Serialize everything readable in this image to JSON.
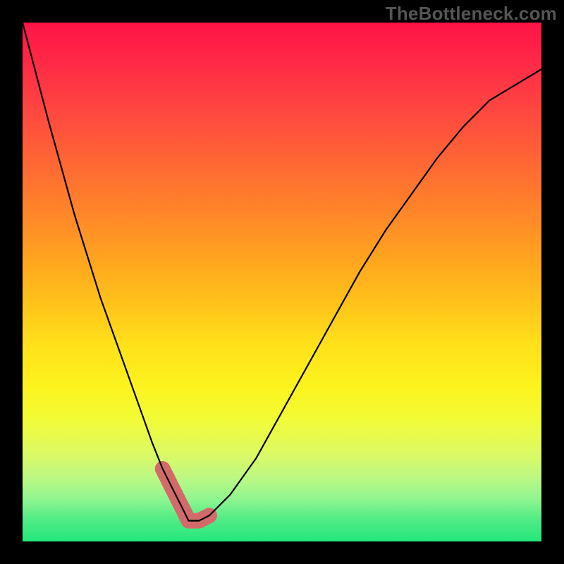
{
  "watermark": "TheBottleneck.com",
  "chart_data": {
    "type": "line",
    "title": "",
    "xlabel": "",
    "ylabel": "",
    "xlim": [
      0,
      100
    ],
    "ylim": [
      0,
      100
    ],
    "grid": false,
    "legend": false,
    "annotations": [],
    "series": [
      {
        "name": "bottleneck-curve",
        "x": [
          0,
          5,
          10,
          15,
          20,
          25,
          27,
          29,
          30,
          31,
          32,
          33,
          34,
          36,
          40,
          45,
          50,
          55,
          60,
          65,
          70,
          75,
          80,
          85,
          90,
          95,
          100
        ],
        "values": [
          100,
          81,
          63,
          47,
          33,
          19,
          14,
          10,
          8,
          6,
          4,
          4,
          4,
          5,
          9,
          16,
          25,
          34,
          43,
          52,
          60,
          67,
          74,
          80,
          85,
          88,
          91
        ]
      },
      {
        "name": "highlight-band",
        "x": [
          27,
          29,
          30,
          31,
          32,
          33,
          34,
          36
        ],
        "values": [
          14,
          10,
          8,
          6,
          4,
          4,
          4,
          5
        ]
      }
    ],
    "colors": {
      "bottleneck-curve": "#000000",
      "highlight-band": "#d36a6a",
      "gradient_top": "#ff1447",
      "gradient_bottom": "#25e77b"
    }
  }
}
